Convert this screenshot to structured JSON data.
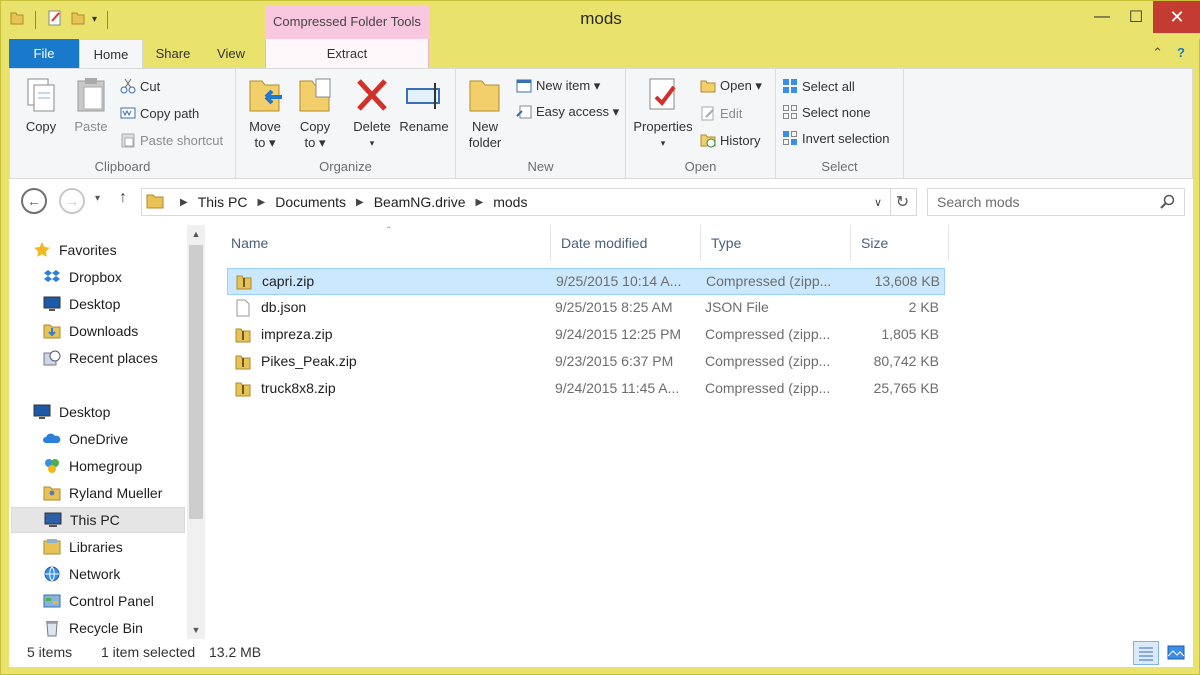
{
  "window": {
    "title": "mods",
    "contextual_tab_group": "Compressed Folder Tools"
  },
  "tabs": [
    {
      "label": "File"
    },
    {
      "label": "Home"
    },
    {
      "label": "Share"
    },
    {
      "label": "View"
    },
    {
      "label": "Extract"
    }
  ],
  "ribbon": {
    "clipboard": {
      "label": "Clipboard",
      "copy": "Copy",
      "paste": "Paste",
      "cut": "Cut",
      "copy_path": "Copy path",
      "paste_shortcut": "Paste shortcut"
    },
    "organize": {
      "label": "Organize",
      "move_to_1": "Move",
      "move_to_2": "to ▾",
      "copy_to_1": "Copy",
      "copy_to_2": "to ▾",
      "delete": "Delete",
      "rename": "Rename"
    },
    "new": {
      "label": "New",
      "new_folder_1": "New",
      "new_folder_2": "folder",
      "new_item": "New item ▾",
      "easy_access": "Easy access ▾"
    },
    "open": {
      "label": "Open",
      "properties": "Properties",
      "open": "Open ▾",
      "edit": "Edit",
      "history": "History"
    },
    "select": {
      "label": "Select",
      "select_all": "Select all",
      "select_none": "Select none",
      "invert_selection": "Invert selection"
    }
  },
  "address": {
    "breadcrumbs": [
      "This PC",
      "Documents",
      "BeamNG.drive",
      "mods"
    ],
    "search_placeholder": "Search mods"
  },
  "nav": {
    "items": [
      {
        "label": "Favorites",
        "icon": "star-icon"
      },
      {
        "label": "Dropbox",
        "icon": "dropbox-icon"
      },
      {
        "label": "Desktop",
        "icon": "desktop-icon"
      },
      {
        "label": "Downloads",
        "icon": "downloads-icon"
      },
      {
        "label": "Recent places",
        "icon": "recent-places-icon"
      },
      {
        "label": "Desktop",
        "icon": "desktop-icon"
      },
      {
        "label": "OneDrive",
        "icon": "onedrive-icon"
      },
      {
        "label": "Homegroup",
        "icon": "homegroup-icon"
      },
      {
        "label": "Ryland Mueller",
        "icon": "user-folder-icon"
      },
      {
        "label": "This PC",
        "icon": "this-pc-icon"
      },
      {
        "label": "Libraries",
        "icon": "libraries-icon"
      },
      {
        "label": "Network",
        "icon": "network-icon"
      },
      {
        "label": "Control Panel",
        "icon": "control-panel-icon"
      },
      {
        "label": "Recycle Bin",
        "icon": "recycle-bin-icon"
      }
    ],
    "selected": "This PC"
  },
  "columns": {
    "name": "Name",
    "date": "Date modified",
    "type": "Type",
    "size": "Size"
  },
  "files": [
    {
      "name": "capri.zip",
      "date": "9/25/2015 10:14 A...",
      "type": "Compressed (zipp...",
      "size": "13,608 KB",
      "selected": true
    },
    {
      "name": "db.json",
      "date": "9/25/2015 8:25 AM",
      "type": "JSON File",
      "size": "2 KB",
      "selected": false
    },
    {
      "name": "impreza.zip",
      "date": "9/24/2015 12:25 PM",
      "type": "Compressed (zipp...",
      "size": "1,805 KB",
      "selected": false
    },
    {
      "name": "Pikes_Peak.zip",
      "date": "9/23/2015 6:37 PM",
      "type": "Compressed (zipp...",
      "size": "80,742 KB",
      "selected": false
    },
    {
      "name": "truck8x8.zip",
      "date": "9/24/2015 11:45 A...",
      "type": "Compressed (zipp...",
      "size": "25,765 KB",
      "selected": false
    }
  ],
  "status": {
    "count": "5 items",
    "selection": "1 item selected",
    "size": "13.2 MB"
  },
  "colors": {
    "frame": "#e9e26c",
    "file_tab": "#1979ca",
    "close": "#c43b31",
    "selection": "#cce8ff",
    "context_tab": "#f9c7df"
  }
}
